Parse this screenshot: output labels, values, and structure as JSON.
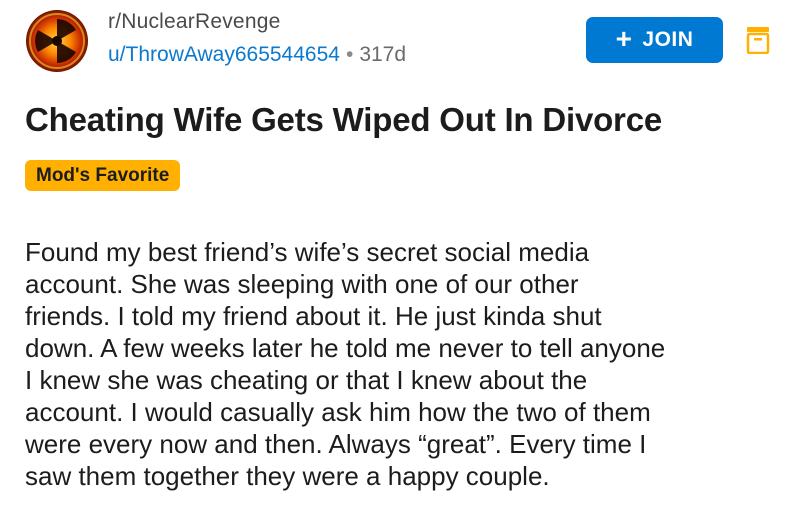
{
  "post": {
    "subreddit": "r/NuclearRevenge",
    "author": "u/ThrowAway665544654",
    "separator": "•",
    "age": "317d",
    "title": "Cheating Wife Gets Wiped Out In Divorce",
    "flair": "Mod's Favorite",
    "body_lines": [
      "Found my best friend’s wife’s secret social media",
      "account. She was sleeping with one of our other",
      "friends. I told my friend about it. He just kinda shut",
      "down. A few weeks later he told me never to tell anyone",
      "I knew she was cheating or that I knew about the",
      "account. I would casually ask him how the two of them",
      "were every now and then. Always “great”. Every time I",
      "saw them together they were a happy couple."
    ]
  },
  "actions": {
    "join_label": "JOIN",
    "join_icon": "plus-icon",
    "save_icon": "bookmark-save-icon"
  },
  "colors": {
    "join_button": "#0079d3",
    "username": "#0b79d0",
    "flair_bg": "#ffb000",
    "save_icon": "#ffb000"
  }
}
